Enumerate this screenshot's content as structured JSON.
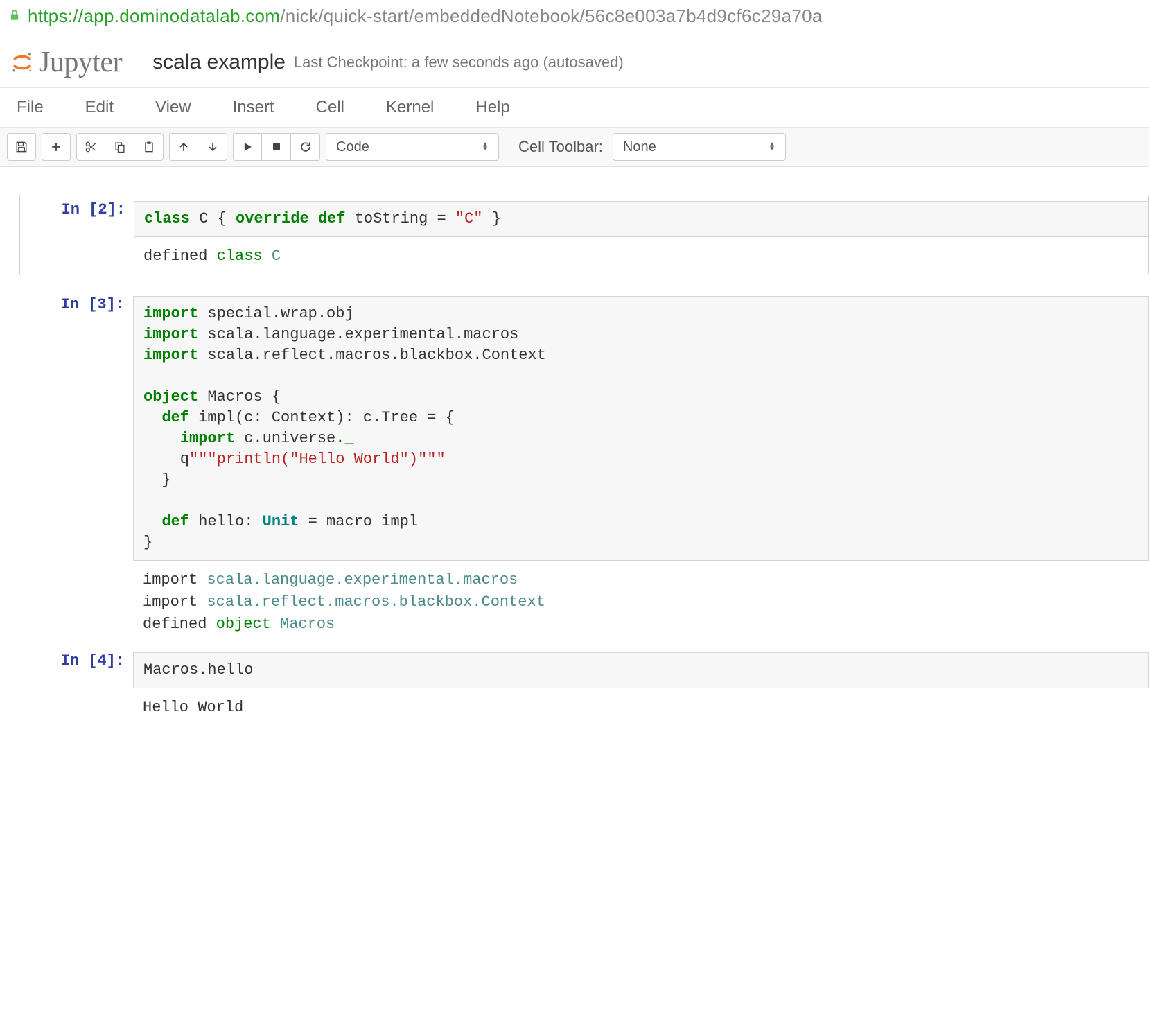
{
  "url": {
    "scheme": "https://",
    "host": "app.dominodatalab.com",
    "path": "/nick/quick-start/embeddedNotebook/56c8e003a7b4d9cf6c29a70a"
  },
  "logo_text": "Jupyter",
  "notebook_name": "scala example",
  "checkpoint": "Last Checkpoint: a few seconds ago (autosaved)",
  "menu": {
    "file": "File",
    "edit": "Edit",
    "view": "View",
    "insert": "Insert",
    "cell": "Cell",
    "kernel": "Kernel",
    "help": "Help"
  },
  "toolbar": {
    "celltype": "Code",
    "celltoolbar_label": "Cell Toolbar:",
    "celltoolbar_value": "None"
  },
  "cells": [
    {
      "prompt": "In [2]:",
      "code_tokens": [
        {
          "t": "class",
          "c": "k-green"
        },
        {
          "t": " C { ",
          "c": ""
        },
        {
          "t": "override",
          "c": "k-green"
        },
        {
          "t": " ",
          "c": ""
        },
        {
          "t": "def",
          "c": "k-green"
        },
        {
          "t": " toString = ",
          "c": ""
        },
        {
          "t": "\"C\"",
          "c": "k-str"
        },
        {
          "t": " }",
          "c": ""
        }
      ],
      "output_tokens": [
        {
          "t": "defined ",
          "c": ""
        },
        {
          "t": "class",
          "c": "k-out-green"
        },
        {
          "t": " ",
          "c": ""
        },
        {
          "t": "C",
          "c": "k-out-teal"
        }
      ]
    },
    {
      "prompt": "In [3]:",
      "code_tokens": [
        {
          "t": "import",
          "c": "k-green"
        },
        {
          "t": " special.wrap.obj\n",
          "c": ""
        },
        {
          "t": "import",
          "c": "k-green"
        },
        {
          "t": " scala.language.experimental.macros\n",
          "c": ""
        },
        {
          "t": "import",
          "c": "k-green"
        },
        {
          "t": " scala.reflect.macros.blackbox.Context\n\n",
          "c": ""
        },
        {
          "t": "object",
          "c": "k-green"
        },
        {
          "t": " Macros {\n  ",
          "c": ""
        },
        {
          "t": "def",
          "c": "k-green"
        },
        {
          "t": " impl(c: Context): c.Tree = {\n    ",
          "c": ""
        },
        {
          "t": "import",
          "c": "k-green"
        },
        {
          "t": " c.universe.",
          "c": ""
        },
        {
          "t": "_",
          "c": "k-green"
        },
        {
          "t": "\n    q",
          "c": ""
        },
        {
          "t": "\"\"\"println(\"Hello World\")\"\"\"",
          "c": "k-str"
        },
        {
          "t": "\n  }\n\n  ",
          "c": ""
        },
        {
          "t": "def",
          "c": "k-green"
        },
        {
          "t": " hello: ",
          "c": ""
        },
        {
          "t": "Unit",
          "c": "k-teal"
        },
        {
          "t": " = macro impl\n}",
          "c": ""
        }
      ],
      "output_tokens": [
        {
          "t": "import ",
          "c": ""
        },
        {
          "t": "scala.language.experimental.macros",
          "c": "k-out-teal"
        },
        {
          "t": "\n",
          "c": ""
        },
        {
          "t": "import ",
          "c": ""
        },
        {
          "t": "scala.reflect.macros.blackbox.Context",
          "c": "k-out-teal"
        },
        {
          "t": "\n",
          "c": ""
        },
        {
          "t": "defined ",
          "c": ""
        },
        {
          "t": "object",
          "c": "k-out-green"
        },
        {
          "t": " ",
          "c": ""
        },
        {
          "t": "Macros",
          "c": "k-out-teal"
        }
      ]
    },
    {
      "prompt": "In [4]:",
      "code_tokens": [
        {
          "t": "Macros.hello",
          "c": ""
        }
      ],
      "output_tokens": [
        {
          "t": "Hello World",
          "c": ""
        }
      ]
    }
  ]
}
